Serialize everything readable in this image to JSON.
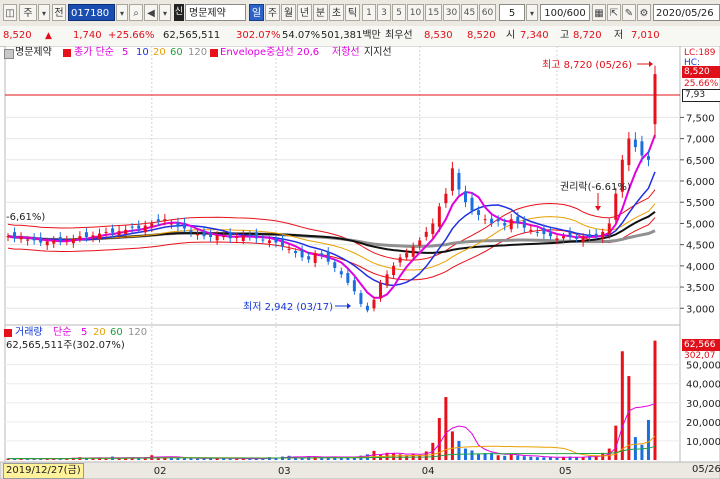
{
  "toolbar": {
    "code": "017180",
    "kind1": "주",
    "kind2": "전",
    "badge": "신",
    "name": "명문제약",
    "periods": [
      "일",
      "주",
      "월",
      "년",
      "분",
      "초",
      "틱"
    ],
    "active_period": "일",
    "intervals": [
      "1",
      "3",
      "5",
      "10",
      "15",
      "30",
      "45",
      "60"
    ],
    "interval_value": "5",
    "count": "100/600",
    "date": "2020/05/26"
  },
  "quote": {
    "price": "8,520",
    "up_arrow": "▲",
    "change": "1,740",
    "change_pct": "+25.66%",
    "volume": "62,565,511",
    "volume_ratio": "302.07%",
    "turnover_pct": "54.07%",
    "amount": "501,381백만",
    "best_label": "최우선",
    "ask": "8,530",
    "bid": "8,520",
    "open_label": "시",
    "open": "7,340",
    "high_label": "고",
    "high": "8,720",
    "low_label": "저",
    "low": "7,010"
  },
  "price_panel": {
    "legend": {
      "name": "명문제약",
      "ma_label": "종가 단순",
      "ma_periods": [
        "5",
        "10",
        "20",
        "60",
        "120"
      ],
      "envelope": "Envelope중심선 20,6",
      "resistance": "저항선",
      "support": "지지선"
    },
    "colors": {
      "ma5": "#e000e0",
      "ma10": "#2030e0",
      "ma20": "#e8a000",
      "ma60": "#20a040",
      "ma120": "#909090",
      "envelope": "#e000e0",
      "up": "#e8101a",
      "down": "#1a6ee0"
    },
    "right_tags": {
      "lc": "LC:189",
      "hc": "HC:",
      "price": "8,520",
      "pct": "25.66%",
      "ref": "7,93"
    },
    "y_ticks": [
      "7,500",
      "7,000",
      "6,500",
      "6,000",
      "5,500",
      "5,000",
      "4,500",
      "4,000",
      "3,500",
      "3,000"
    ],
    "annotations": {
      "high": "최고 8,720 (05/26)",
      "low": "최저 2,942 (03/17)",
      "rights": "권리락(-6.61%)",
      "left_pct": "-6,61%)"
    }
  },
  "volume_panel": {
    "legend": {
      "name": "거래량",
      "ma_label": "단순",
      "ma_periods": [
        "5",
        "20",
        "60",
        "120"
      ],
      "current": "62,565,511주(302.07%)"
    },
    "right_tags": {
      "value": "62,566",
      "pct": "302,07"
    },
    "y_ticks": [
      "50,000",
      "40,000",
      "30,000",
      "20,000",
      "10,000"
    ]
  },
  "x_axis": {
    "first_date": "2019/12/27(금)",
    "months": [
      "02",
      "03",
      "04",
      "05"
    ],
    "last_date": "05/26"
  },
  "chart_data": [
    {
      "type": "candlestick",
      "title": "",
      "y_unit": "KRW",
      "ylim": [
        2700,
        8900
      ],
      "x": [
        "2019-12-27",
        "...",
        "2020-05-26"
      ],
      "candles_shown": 100,
      "key_points": {
        "high": {
          "date": "05/26",
          "value": 8720
        },
        "low": {
          "date": "03/17",
          "value": 2942
        },
        "last_close": 8520,
        "last_open": 7340,
        "last_low": 7010
      },
      "approx_closes": [
        4700,
        4650,
        4680,
        4620,
        4600,
        4550,
        4580,
        4600,
        4560,
        4620,
        4640,
        4700,
        4680,
        4720,
        4760,
        4800,
        4780,
        4820,
        4850,
        4900,
        4880,
        4950,
        5000,
        5050,
        5100,
        5000,
        4920,
        4880,
        4800,
        4750,
        4700,
        4680,
        4720,
        4700,
        4650,
        4680,
        4720,
        4700,
        4650,
        4620,
        4600,
        4550,
        4450,
        4400,
        4300,
        4200,
        4150,
        4300,
        4250,
        4100,
        3950,
        3800,
        3600,
        3400,
        3100,
        2950,
        3200,
        3600,
        3800,
        4000,
        4200,
        4300,
        4450,
        4600,
        4800,
        5000,
        5400,
        5700,
        6300,
        5800,
        5500,
        5300,
        5200,
        5100,
        5000,
        5050,
        4950,
        5100,
        5000,
        4900,
        4850,
        4800,
        4750,
        4700,
        4650,
        4700,
        4680,
        4650,
        4700,
        4680,
        4720,
        4800,
        5000,
        5700,
        6500,
        7000,
        6800,
        6600,
        6500,
        8520
      ],
      "moving_averages": [
        "5",
        "10",
        "20",
        "60",
        "120"
      ],
      "envelope": "20,6"
    },
    {
      "type": "bar",
      "title": "",
      "ylim": [
        0,
        65000
      ],
      "series": [
        {
          "name": "거래량",
          "values_last": 62566
        }
      ],
      "approx_volumes": [
        800,
        700,
        900,
        600,
        650,
        700,
        800,
        900,
        700,
        650,
        1200,
        1500,
        1300,
        900,
        800,
        1000,
        1800,
        1300,
        1200,
        1100,
        900,
        1500,
        2500,
        1800,
        1500,
        1300,
        1000,
        900,
        800,
        700,
        900,
        1100,
        1000,
        800,
        700,
        650,
        700,
        900,
        800,
        700,
        1500,
        1200,
        1800,
        2200,
        1500,
        1300,
        2000,
        1800,
        1600,
        1200,
        1500,
        1700,
        1800,
        1600,
        2300,
        3000,
        4800,
        2600,
        3800,
        3500,
        3000,
        2500,
        3200,
        2700,
        4500,
        9000,
        22000,
        33000,
        15000,
        10000,
        6000,
        5000,
        3000,
        3600,
        3800,
        2500,
        2200,
        2800,
        2400,
        2000,
        1700,
        1500,
        1400,
        1300,
        1200,
        1600,
        1800,
        1400,
        1500,
        2000,
        2200,
        3600,
        6000,
        18000,
        57000,
        44000,
        12000,
        8000,
        21000,
        62566
      ]
    }
  ]
}
